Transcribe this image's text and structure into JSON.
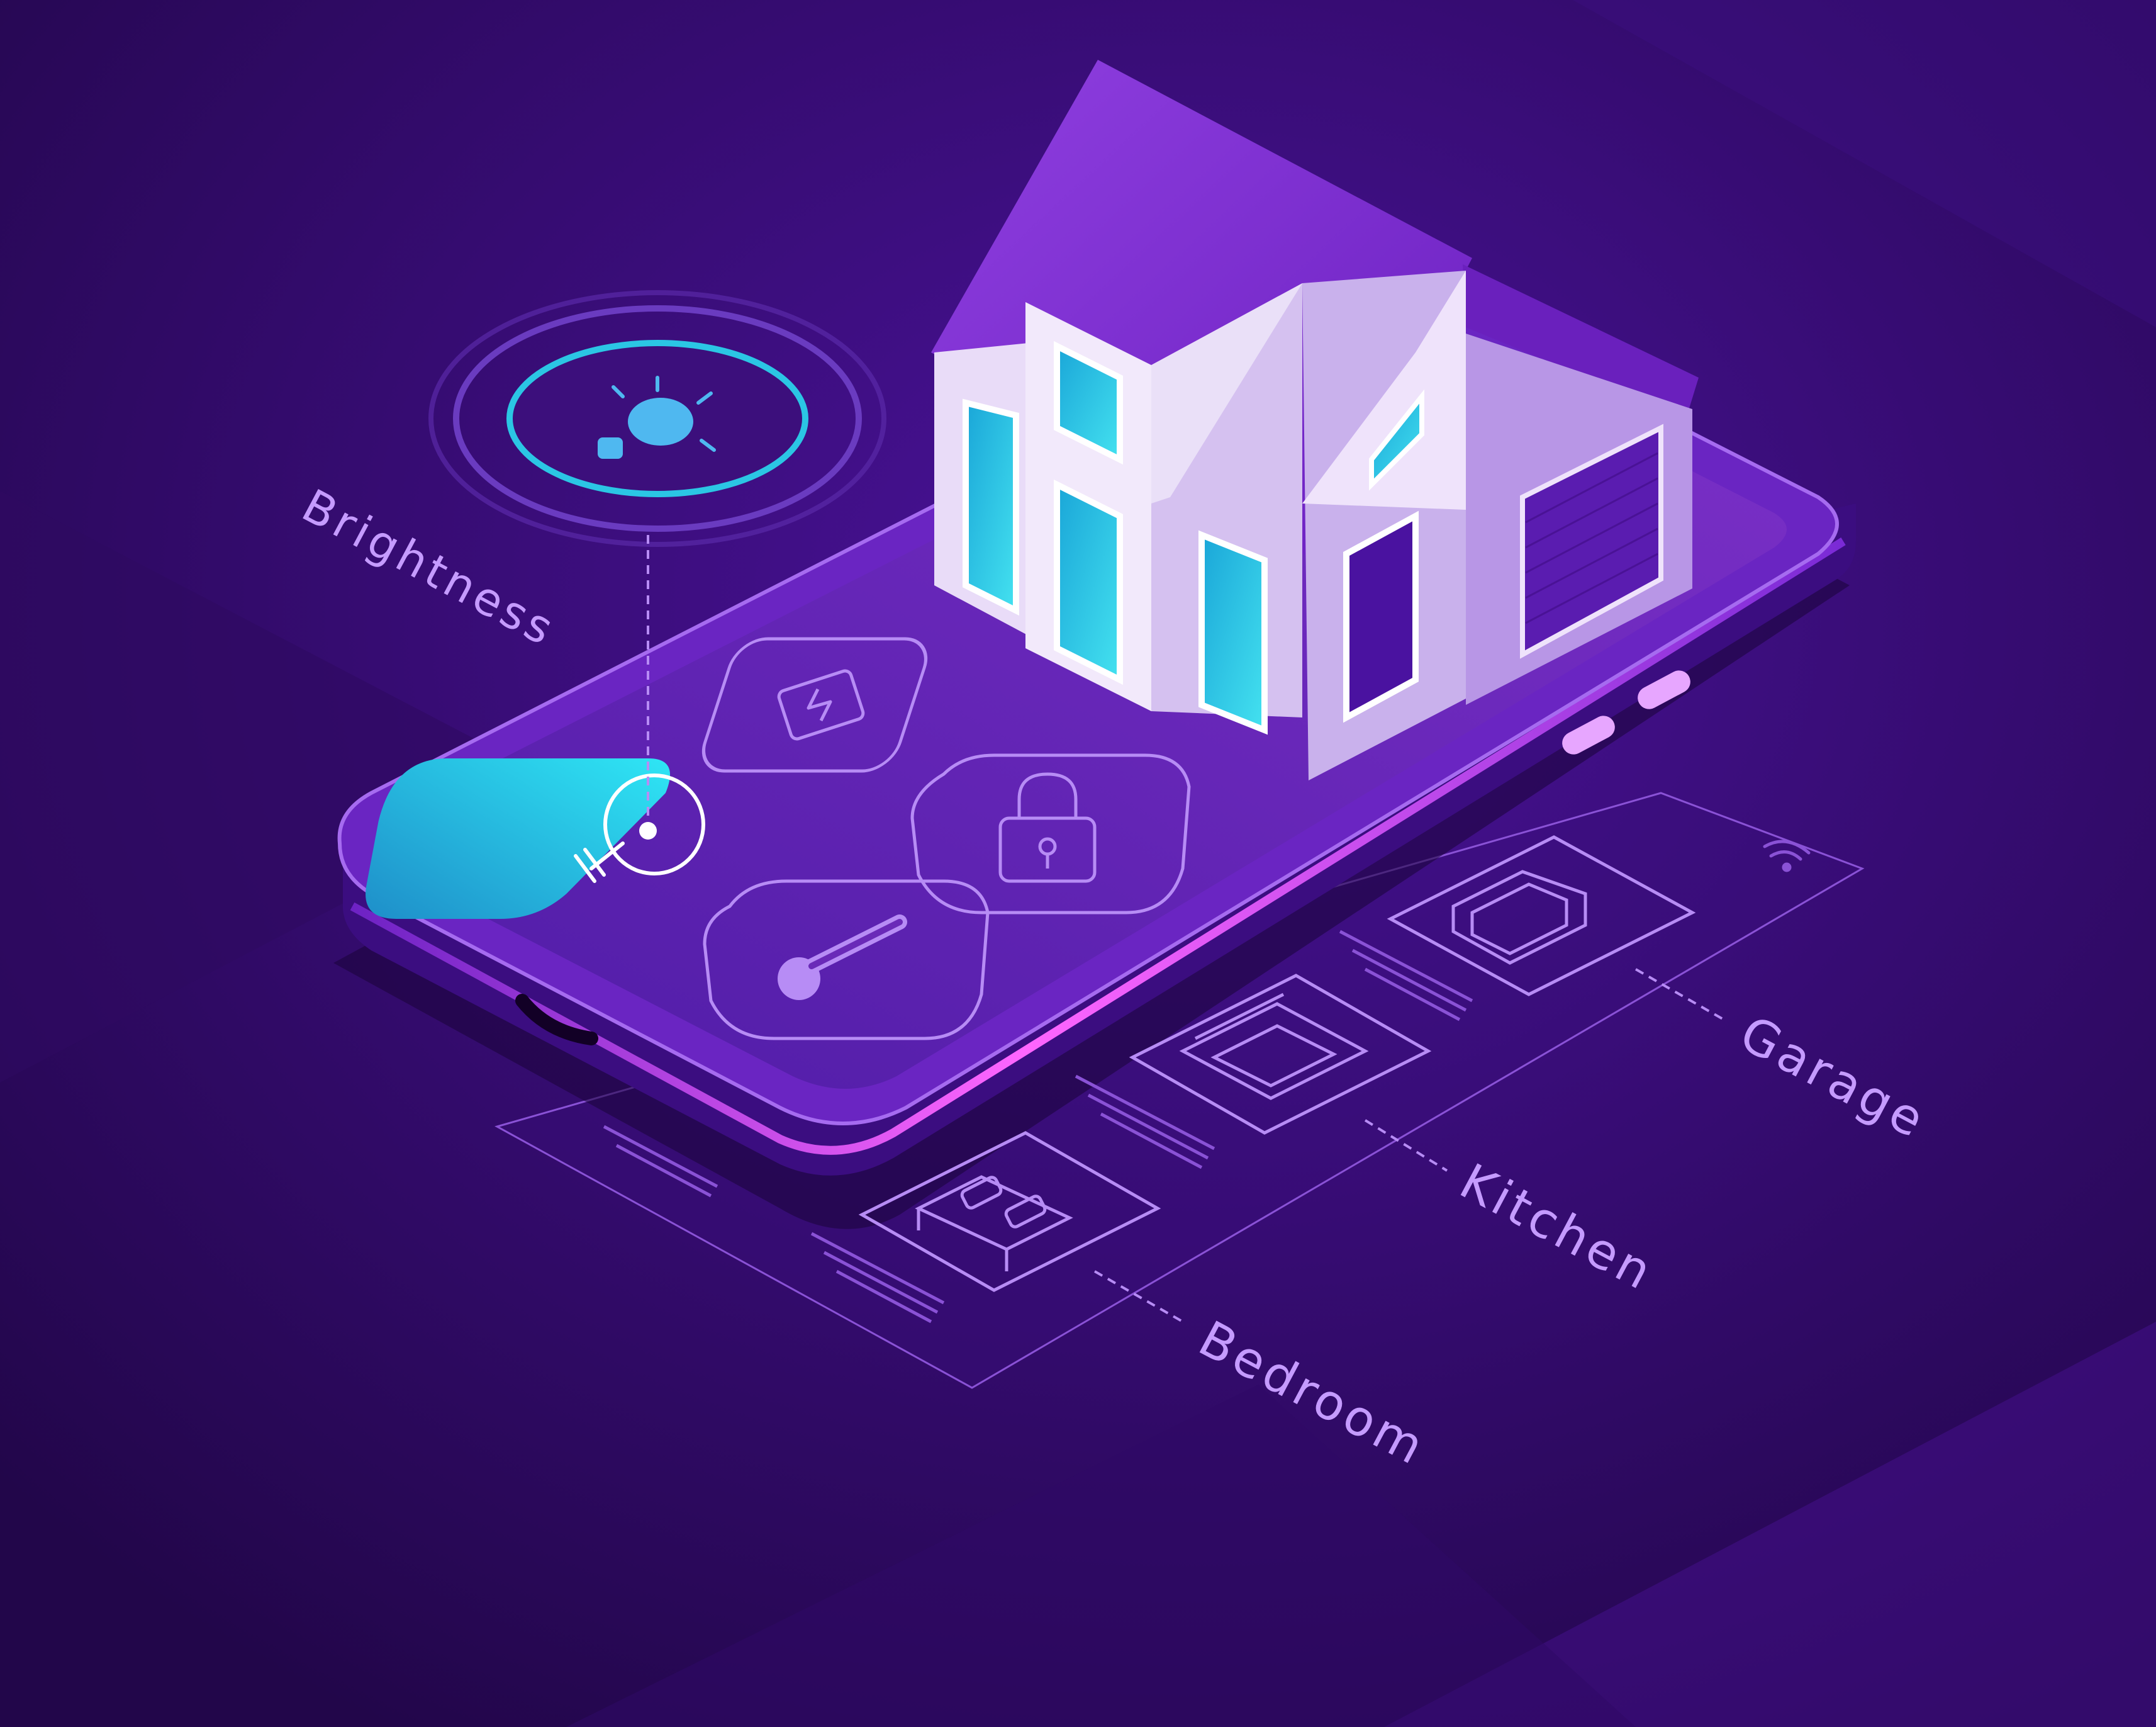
{
  "labels": {
    "brightness": "Brightness",
    "garage": "Garage",
    "kitchen": "Kitchen",
    "bedroom": "Bedroom"
  },
  "app_tiles": [
    {
      "icon": "battery-charging-icon",
      "active": false
    },
    {
      "icon": "lightbulb-icon",
      "active": true
    },
    {
      "icon": "padlock-icon",
      "active": false
    },
    {
      "icon": "thermometer-icon",
      "active": false
    }
  ],
  "rooms": [
    {
      "icon": "garage-icon"
    },
    {
      "icon": "oven-icon"
    },
    {
      "icon": "bed-icon"
    }
  ],
  "status_icons": {
    "wifi": "wifi-icon",
    "brightness_dial": "lightbulb-icon"
  },
  "colors": {
    "background": "#2a0858",
    "phone_body": "#5e1fb0",
    "phone_edge_glow": "#d84cff",
    "screen": "#6a2ab8",
    "active_tile": "#23c9ec",
    "line_art": "#b78cf5",
    "house_wall": "#dccbf2",
    "house_roof": "#7a22c9",
    "window_glass": "#2bc6e4",
    "label_text": "#c59bff"
  }
}
